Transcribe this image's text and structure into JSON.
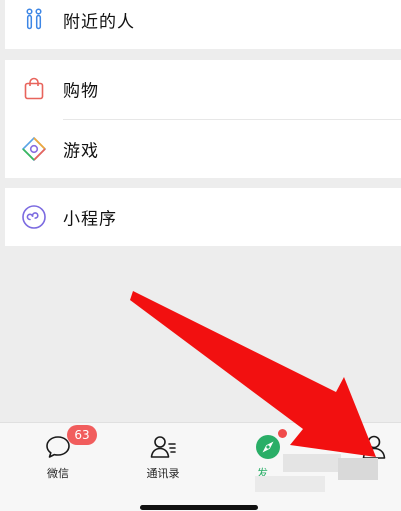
{
  "menu": {
    "nearby_label": "附近的人",
    "shopping_label": "购物",
    "games_label": "游戏",
    "mini_programs_label": "小程序"
  },
  "tabbar": {
    "chats_label": "微信",
    "chats_badge": "63",
    "contacts_label": "通讯录",
    "discover_label": "发",
    "me_label": ""
  },
  "colors": {
    "accent_green": "#2aae67",
    "badge_red": "#f15d5d",
    "arrow_red": "#f21010"
  }
}
